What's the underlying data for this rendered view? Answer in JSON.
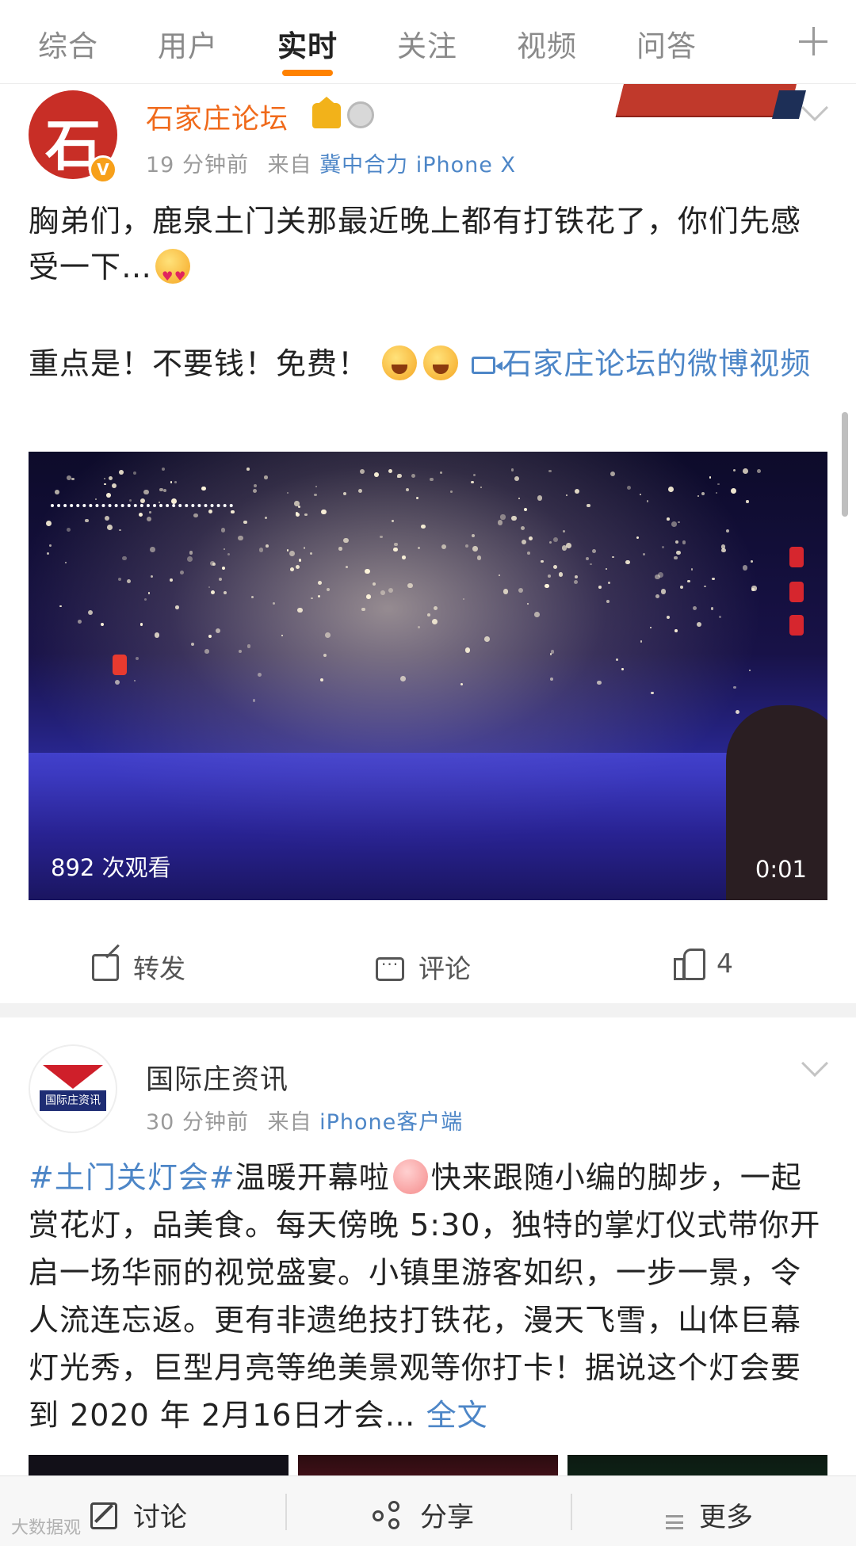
{
  "tabs": [
    "综合",
    "用户",
    "实时",
    "关注",
    "视频",
    "问答"
  ],
  "active_tab": "实时",
  "colors": {
    "accent": "#ff8200",
    "link": "#4d86c7",
    "vip_name": "#f06a1b"
  },
  "post1": {
    "avatar_glyph": "石",
    "username": "石家庄论坛",
    "time": "19 分钟前",
    "from_label": "来自",
    "source": "冀中合力 iPhone X",
    "text_line1": "胸弟们，鹿泉土门关那最近晚上都有打铁花了，你们先感受一下…",
    "text_line2": "重点是！不要钱！免费！",
    "video_link": "石家庄论坛的微博视频",
    "video": {
      "views": "892 次观看",
      "duration": "0:01"
    },
    "actions": {
      "forward": "转发",
      "comment": "评论",
      "like_count": "4"
    }
  },
  "post2": {
    "avatar_text": "国际庄资讯",
    "username": "国际庄资讯",
    "time": "30 分钟前",
    "from_label": "来自",
    "source": "iPhone客户端",
    "hashtag": "#土门关灯会#",
    "text_a": "温暖开幕啦",
    "text_b": "快来跟随小编的脚步，一起赏花灯，品美食。每天傍晚 5:30，独特的掌灯仪式带你开启一场华丽的视觉盛宴。小镇里游客如织，一步一景，令人流连忘返。更有非遗绝技打铁花，漫天飞雪，山体巨幕灯光秀，巨型月亮等绝美景观等你打卡！据说这个灯会要到 2020 年 2月16日才会…",
    "full_text_link": "全文"
  },
  "bottom_bar": {
    "discuss": "讨论",
    "share": "分享",
    "more": "更多"
  },
  "watermark": "大数据观"
}
